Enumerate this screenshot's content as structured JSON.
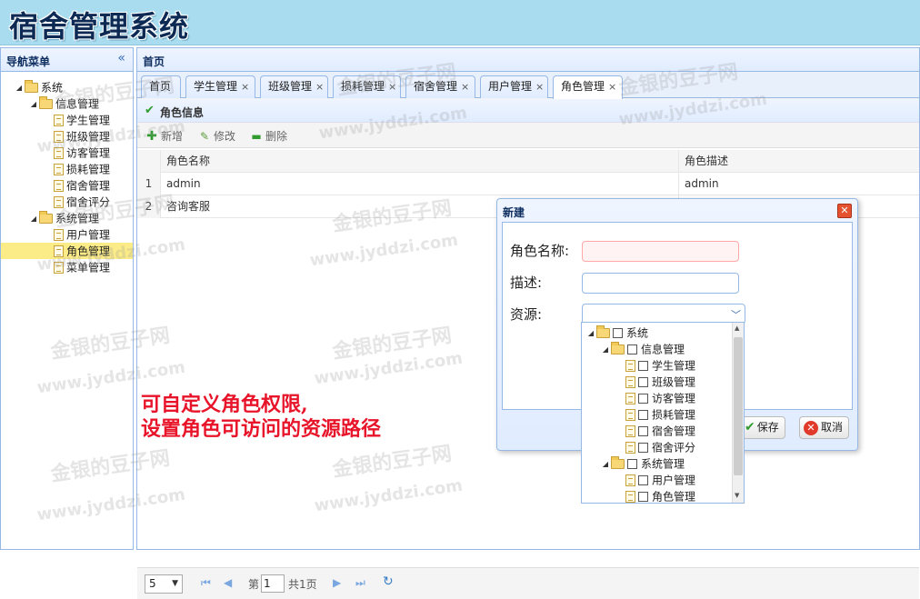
{
  "app": {
    "title": "宿舍管理系统"
  },
  "sidebar": {
    "title": "导航菜单",
    "collapse_icon": "double-chevron-left-icon",
    "tree": [
      {
        "label": "系统",
        "type": "folder",
        "level": 0
      },
      {
        "label": "信息管理",
        "type": "folder",
        "level": 1
      },
      {
        "label": "学生管理",
        "type": "file",
        "level": 2
      },
      {
        "label": "班级管理",
        "type": "file",
        "level": 2
      },
      {
        "label": "访客管理",
        "type": "file",
        "level": 2
      },
      {
        "label": "损耗管理",
        "type": "file",
        "level": 2
      },
      {
        "label": "宿舍管理",
        "type": "file",
        "level": 2
      },
      {
        "label": "宿舍评分",
        "type": "file",
        "level": 2
      },
      {
        "label": "系统管理",
        "type": "folder",
        "level": 1
      },
      {
        "label": "用户管理",
        "type": "file",
        "level": 2
      },
      {
        "label": "角色管理",
        "type": "file",
        "level": 2,
        "selected": true
      },
      {
        "label": "菜单管理",
        "type": "file",
        "level": 2
      }
    ]
  },
  "main": {
    "title": "首页",
    "tabs": [
      {
        "label": "首页",
        "closable": false
      },
      {
        "label": "学生管理",
        "closable": true
      },
      {
        "label": "班级管理",
        "closable": true
      },
      {
        "label": "损耗管理",
        "closable": true
      },
      {
        "label": "宿舍管理",
        "closable": true
      },
      {
        "label": "用户管理",
        "closable": true
      },
      {
        "label": "角色管理",
        "closable": true,
        "active": true
      }
    ],
    "tab_close_glyph": "×"
  },
  "grid": {
    "title": "角色信息",
    "toolbar": {
      "add": "新增",
      "edit": "修改",
      "delete": "删除"
    },
    "columns": [
      "角色名称",
      "角色描述"
    ],
    "rows": [
      {
        "index": "1",
        "name": "admin",
        "desc": "admin"
      },
      {
        "index": "2",
        "name": "咨询客服",
        "desc": ""
      }
    ]
  },
  "pager": {
    "page_size": "5",
    "page_prefix": "第",
    "page_value": "1",
    "total": "共1页"
  },
  "dialog": {
    "title": "新建",
    "fields": {
      "name_label": "角色名称:",
      "desc_label": "描述:",
      "resource_label": "资源:"
    },
    "save_label": "保存",
    "cancel_label": "取消"
  },
  "resource_tree": [
    {
      "label": "系统",
      "type": "folder",
      "level": 0
    },
    {
      "label": "信息管理",
      "type": "folder",
      "level": 1
    },
    {
      "label": "学生管理",
      "type": "file",
      "level": 2
    },
    {
      "label": "班级管理",
      "type": "file",
      "level": 2
    },
    {
      "label": "访客管理",
      "type": "file",
      "level": 2
    },
    {
      "label": "损耗管理",
      "type": "file",
      "level": 2
    },
    {
      "label": "宿舍管理",
      "type": "file",
      "level": 2
    },
    {
      "label": "宿舍评分",
      "type": "file",
      "level": 2
    },
    {
      "label": "系统管理",
      "type": "folder",
      "level": 1
    },
    {
      "label": "用户管理",
      "type": "file",
      "level": 2
    },
    {
      "label": "角色管理",
      "type": "file",
      "level": 2
    }
  ],
  "annotation": {
    "line1": "可自定义角色权限,",
    "line2": "设置角色可访问的资源路径"
  },
  "watermark": {
    "text1": "金银的豆子网",
    "text2": "www.jyddzi.com"
  },
  "colors": {
    "header_bg": "#a9dcee",
    "panel_border": "#95b8e7",
    "selected_row": "#fbec88",
    "annotation": "#e8142a"
  }
}
